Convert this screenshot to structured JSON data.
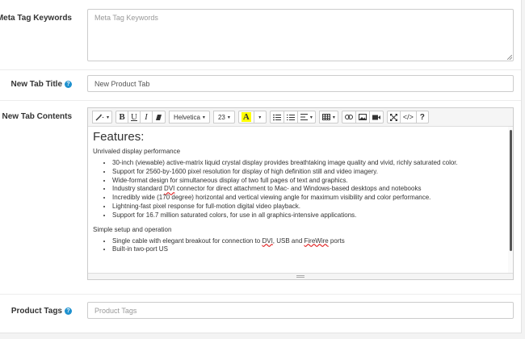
{
  "meta_keywords": {
    "label": "Meta Tag Keywords",
    "placeholder": "Meta Tag Keywords",
    "value": ""
  },
  "new_tab_title": {
    "label": "New Tab Title",
    "value": "New Product Tab"
  },
  "new_tab_contents": {
    "label": "New Tab Contents",
    "toolbar": {
      "font_family": "Helvetica",
      "font_size": "23",
      "bold": "B",
      "underline": "U",
      "italic": "I",
      "color": "A",
      "help": "?",
      "code_view": "</>"
    },
    "content": {
      "heading": "Features:",
      "section1_title": "Unrivaled display performance",
      "section1_items": [
        "30-inch (viewable) active-matrix liquid crystal display provides breathtaking image quality and vivid, richly saturated color.",
        "Support for 2560-by-1600 pixel resolution for display of high definition still and video imagery.",
        "Wide-format design for simultaneous display of two full pages of text and graphics.",
        "Incredibly wide (170 degree) horizontal and vertical viewing angle for maximum visibility and color performance.",
        "Lightning-fast pixel response for full-motion digital video playback.",
        "Support for 16.7 million saturated colors, for use in all graphics-intensive applications."
      ],
      "industry_item": {
        "pre": "Industry standard ",
        "dvi": "DVI",
        "post": " connector for direct attachment to Mac- and Windows-based desktops and notebooks"
      },
      "section2_title": "Simple setup and operation",
      "cable_item": {
        "pre": "Single cable with elegant breakout for connection to ",
        "dvi": "DVI",
        "mid": ", USB and ",
        "firewire": "FireWire",
        "post": " ports"
      },
      "section2_items": [
        "Built-in two-port US"
      ]
    }
  },
  "product_tags": {
    "label": "Product Tags",
    "placeholder": "Product Tags",
    "value": ""
  },
  "colors": {
    "help_icon": "#1e91cf",
    "border": "#cccccc"
  }
}
